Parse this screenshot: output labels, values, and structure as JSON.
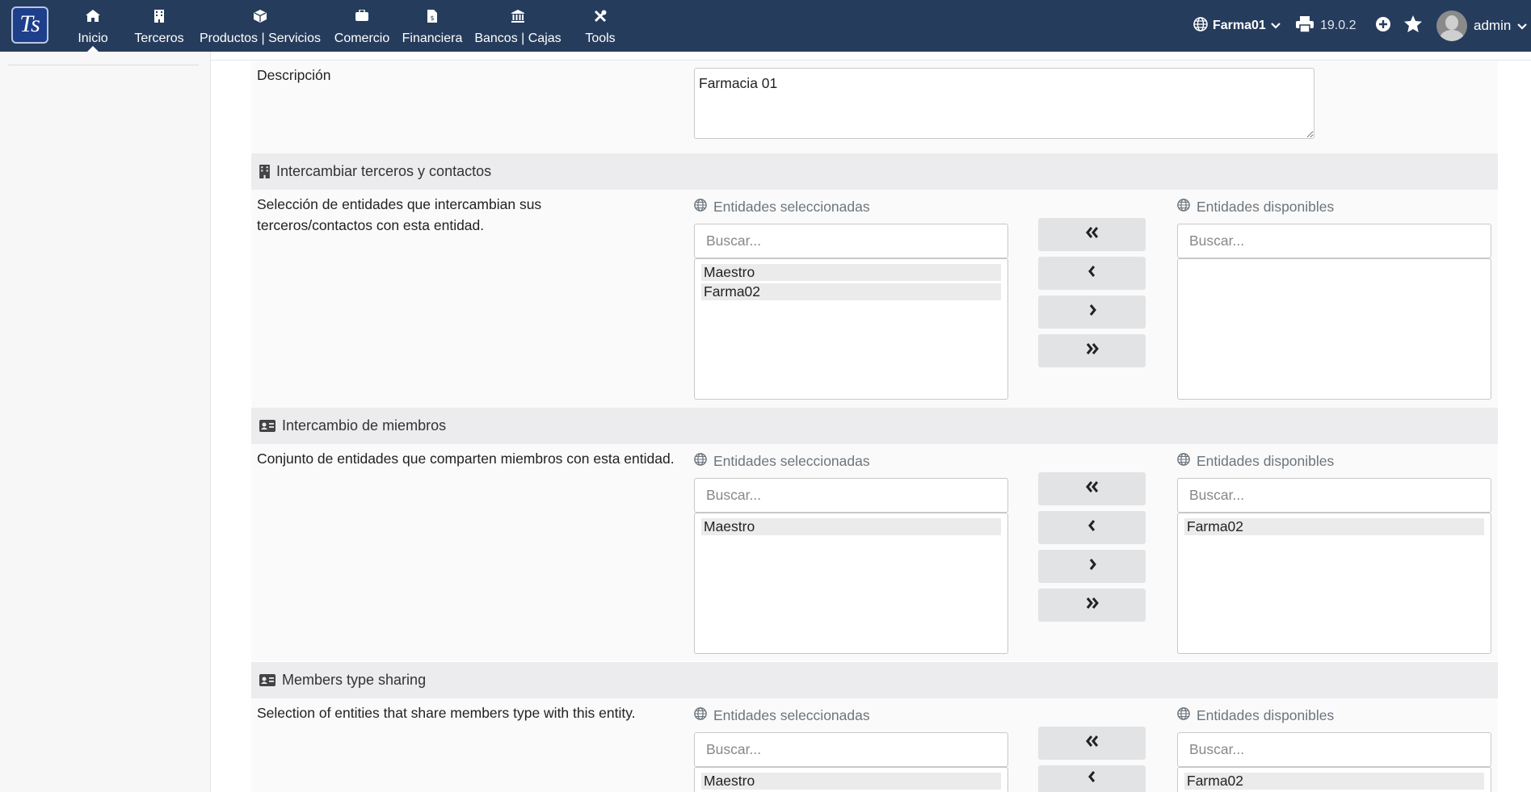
{
  "topbar": {
    "logo_text": "Ts",
    "nav": [
      {
        "label": "Inicio",
        "icon": "home-icon"
      },
      {
        "label": "Terceros",
        "icon": "building-icon"
      },
      {
        "label": "Productos | Servicios",
        "icon": "cube-icon"
      },
      {
        "label": "Comercio",
        "icon": "briefcase-icon"
      },
      {
        "label": "Financiera",
        "icon": "file-invoice-icon"
      },
      {
        "label": "Bancos | Cajas",
        "icon": "bank-icon"
      },
      {
        "label": "Tools",
        "icon": "tools-icon"
      }
    ],
    "active_nav": "Inicio",
    "entity": "Farma01",
    "version": "19.0.2",
    "user": "admin"
  },
  "form": {
    "description_label": "Descripción",
    "description_value": "Farmacia 01"
  },
  "sections": [
    {
      "title": "Intercambiar terceros y contactos",
      "icon": "building-icon",
      "text": "Selección de entidades que intercambian sus terceros/contactos con esta entidad.",
      "selected_title": "Entidades seleccionadas",
      "available_title": "Entidades disponibles",
      "search_placeholder": "Buscar...",
      "selected_items": [
        "Maestro",
        "Farma02"
      ],
      "available_items": []
    },
    {
      "title": "Intercambio de miembros",
      "icon": "id-card-icon",
      "text": "Conjunto de entidades que comparten miembros con esta entidad.",
      "selected_title": "Entidades seleccionadas",
      "available_title": "Entidades disponibles",
      "search_placeholder": "Buscar...",
      "selected_items": [
        "Maestro"
      ],
      "available_items": [
        "Farma02"
      ]
    },
    {
      "title": "Members type sharing",
      "icon": "id-card-icon",
      "text": "Selection of entities that share members type with this entity.",
      "selected_title": "Entidades seleccionadas",
      "available_title": "Entidades disponibles",
      "search_placeholder": "Buscar...",
      "selected_items": [
        "Maestro"
      ],
      "available_items": [
        "Farma02"
      ]
    }
  ],
  "colors": {
    "topbar": "#263c5c",
    "section_header": "#ececef",
    "button": "#e2e3e5"
  }
}
